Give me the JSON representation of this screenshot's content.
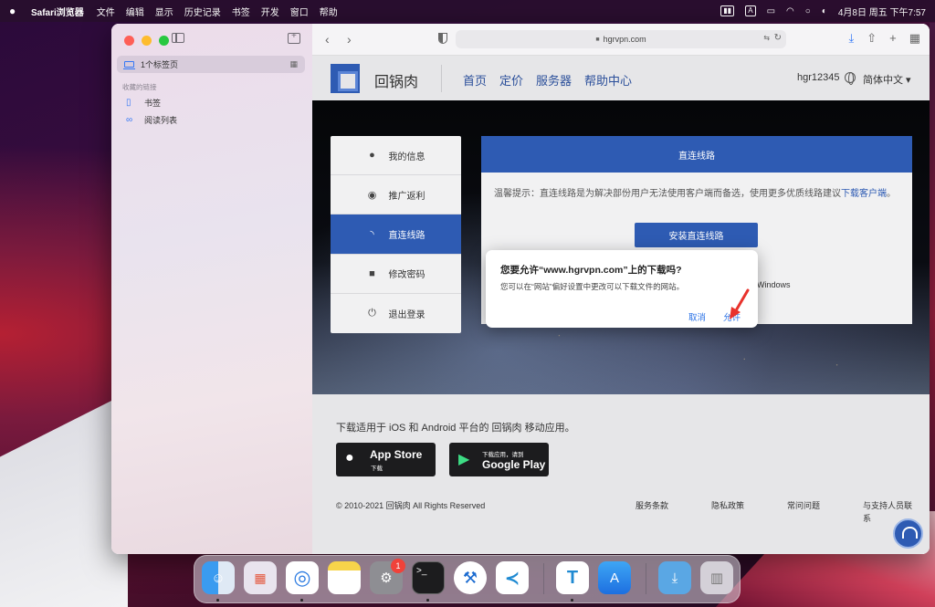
{
  "menubar": {
    "app_name": "Safari浏览器",
    "items": [
      "文件",
      "编辑",
      "显示",
      "历史记录",
      "书签",
      "开发",
      "窗口",
      "帮助"
    ],
    "clock": "4月8日 周五 下午7:57",
    "input_method": "A"
  },
  "sidebar": {
    "tab_group": "1个标签页",
    "section_title": "收藏的链接",
    "items": [
      {
        "label": "书签",
        "icon": "bookmark-icon"
      },
      {
        "label": "阅读列表",
        "icon": "glasses-icon"
      }
    ]
  },
  "toolbar": {
    "url": "hgrvpn.com"
  },
  "site": {
    "brand": "回锅肉",
    "nav": [
      "首页",
      "定价",
      "服务器",
      "帮助中心"
    ],
    "username": "hgr12345",
    "language": "简体中文"
  },
  "account_menu": [
    {
      "label": "我的信息",
      "icon": "user-icon",
      "active": false
    },
    {
      "label": "推广返利",
      "icon": "podcast-icon",
      "active": false
    },
    {
      "label": "直连线路",
      "icon": "rss-icon",
      "active": true
    },
    {
      "label": "修改密码",
      "icon": "lock-icon",
      "active": false
    },
    {
      "label": "退出登录",
      "icon": "power-icon",
      "active": false
    }
  ],
  "content": {
    "heading": "直连线路",
    "tip_prefix": "温馨提示：直连线路是为解决部份用户无法使用客户端而备选，使用更多优质线路建议",
    "tip_link": "下载客户端",
    "tip_suffix": "。",
    "install_button": "安装直连线路",
    "windows_text": "Windows"
  },
  "dialog": {
    "title": "您要允许“www.hgrvpn.com”上的下载吗?",
    "message": "您可以在“网站”偏好设置中更改可以下载文件的网站。",
    "cancel": "取消",
    "allow": "允许"
  },
  "footer": {
    "download_text": "下载适用于 iOS 和 Android 平台的 回锅肉 移动应用。",
    "appstore_big": "App Store",
    "appstore_small": "下载",
    "googleplay_small": "下载应用，请到",
    "googleplay_big": "Google Play",
    "copyright": "© 2010-2021 回锅肉 All Rights Reserved",
    "links": [
      "服务条款",
      "隐私政策",
      "常问问题",
      "与支持人员联系"
    ]
  },
  "dock": {
    "settings_badge": "1"
  },
  "colors": {
    "accent": "#2e5bb3",
    "link": "#2e74e6"
  }
}
